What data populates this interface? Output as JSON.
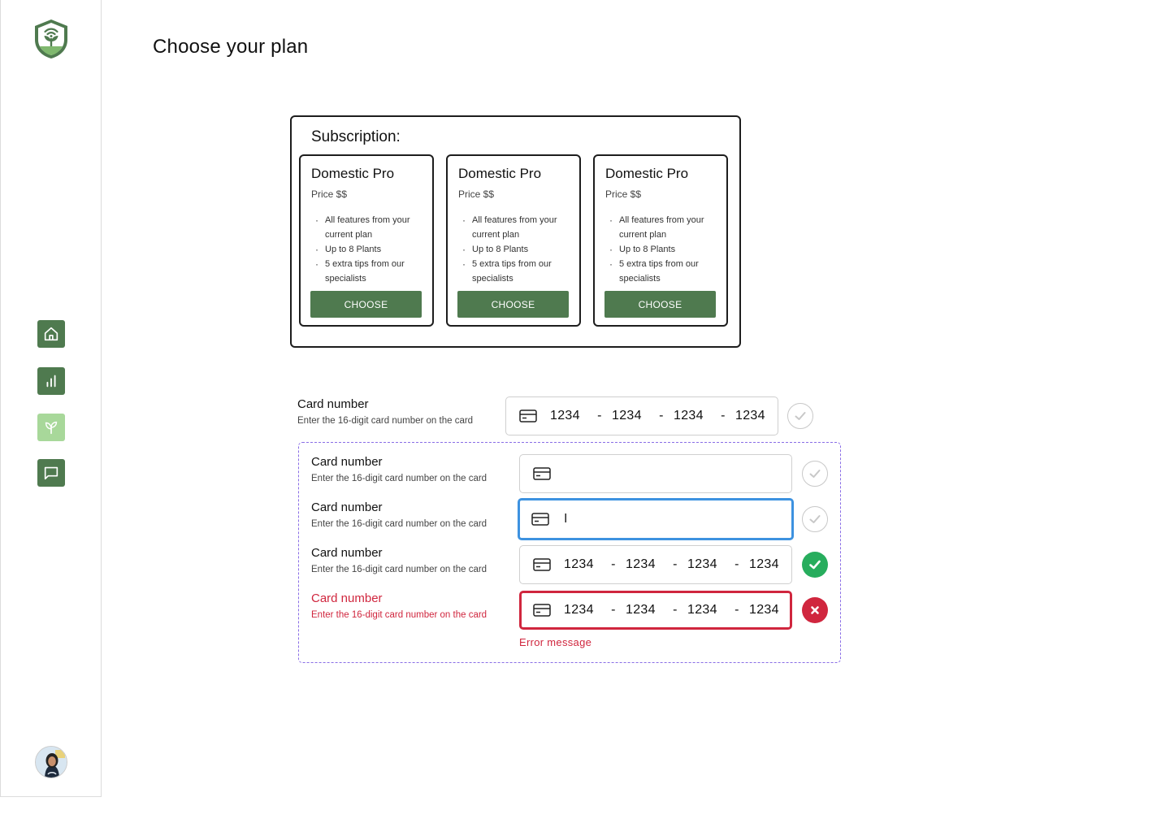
{
  "page": {
    "title": "Choose your plan"
  },
  "sidebar": {
    "logo": "plant-shield-logo",
    "nav": [
      {
        "name": "home",
        "icon": "home-icon"
      },
      {
        "name": "stats",
        "icon": "bar-chart-icon"
      },
      {
        "name": "plants",
        "icon": "sprout-icon"
      },
      {
        "name": "messages",
        "icon": "chat-icon"
      }
    ],
    "avatar": "user-avatar"
  },
  "subscription": {
    "title": "Subscription:",
    "plans": [
      {
        "name": "Domestic Pro",
        "price": "Price $$",
        "features": [
          "All features from your current plan",
          "Up to 8 Plants",
          "5 extra tips from our specialists"
        ],
        "button": "CHOOSE"
      },
      {
        "name": "Domestic Pro",
        "price": "Price $$",
        "features": [
          "All features from your current plan",
          "Up to 8 Plants",
          "5 extra tips from our specialists"
        ],
        "button": "CHOOSE"
      },
      {
        "name": "Domestic Pro",
        "price": "Price $$",
        "features": [
          "All features from your current plan",
          "Up to 8 Plants",
          "5 extra tips from our specialists"
        ],
        "button": "CHOOSE"
      }
    ]
  },
  "card_fields": [
    {
      "state": "default-filled",
      "label": "Card number",
      "hint": "Enter the 16-digit card number on the card",
      "groups": [
        "1234",
        "1234",
        "1234",
        "1234"
      ],
      "separator": "-",
      "status": "neutral"
    },
    {
      "state": "empty",
      "label": "Card number",
      "hint": "Enter the 16-digit card number on the card",
      "groups": [],
      "separator": "-",
      "status": "neutral"
    },
    {
      "state": "focused",
      "label": "Card number",
      "hint": "Enter the 16-digit card number on the card",
      "cursor": "I",
      "groups": [],
      "separator": "-",
      "status": "neutral"
    },
    {
      "state": "success",
      "label": "Card number",
      "hint": "Enter the 16-digit card number on the card",
      "groups": [
        "1234",
        "1234",
        "1234",
        "1234"
      ],
      "separator": "-",
      "status": "success"
    },
    {
      "state": "error",
      "label": "Card number",
      "hint": "Enter the 16-digit card number on the card",
      "groups": [
        "1234",
        "1234",
        "1234",
        "1234"
      ],
      "separator": "-",
      "status": "error"
    }
  ],
  "error_message": "Error message",
  "colors": {
    "brand_green": "#4f7a4f",
    "light_green": "#a8d89a",
    "focus_blue": "#3d92e0",
    "error_red": "#d0263e",
    "success_green": "#27ad5d",
    "dashed_purple": "#8a6ee6"
  }
}
